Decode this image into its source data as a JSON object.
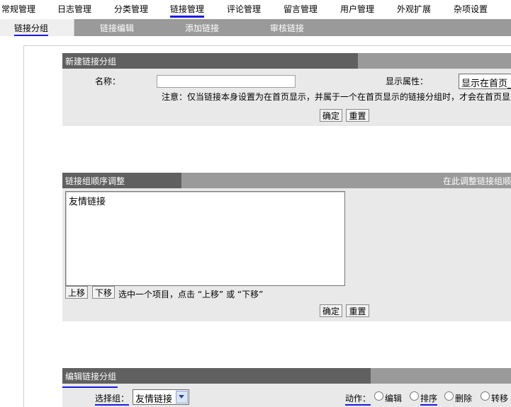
{
  "top_nav": {
    "items": [
      "常规管理",
      "日志管理",
      "分类管理",
      "链接管理",
      "评论管理",
      "留言管理",
      "用户管理",
      "外观扩展",
      "杂项设置"
    ],
    "active_index": 3
  },
  "sub_nav": {
    "tabs": [
      "链接分组",
      "链接编辑",
      "添加链接",
      "审核链接"
    ],
    "active_index": 0
  },
  "new_group": {
    "title": "新建链接分组",
    "name_label": "名称：",
    "name_value": "",
    "display_label": "显示属性：",
    "display_value": "显示在首页_",
    "note": "注意：仅当链接本身设置为在首页显示，并属于一个在首页显示的链接分组时，才会在首页显",
    "confirm": "确定",
    "reset": "重置"
  },
  "order_panel": {
    "title": "链接组顺序调整",
    "title_right": "在此调整链接组顺",
    "list_items": [
      "友情链接"
    ],
    "move_up": "上移",
    "move_down": "下移",
    "hint": "选中一个项目，点击 “上移” 或 “下移”",
    "confirm": "确定",
    "reset": "重置"
  },
  "edit_group": {
    "title": "编辑链接分组",
    "select_label": "选择组：",
    "select_value": "友情链接",
    "action_label": "动作：",
    "actions": [
      "编辑",
      "排序",
      "删除",
      "转移"
    ],
    "accent_color": "#1a1ae6"
  }
}
